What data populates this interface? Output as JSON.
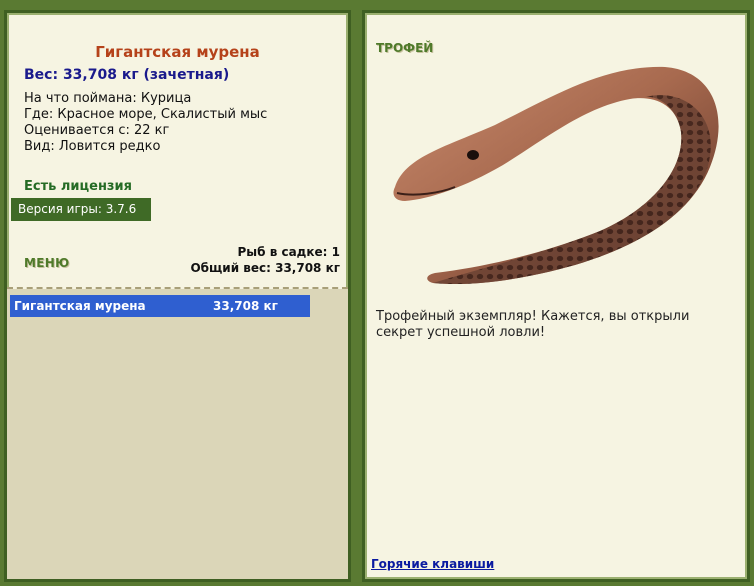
{
  "fish": {
    "name": "Гигантская мурена",
    "weight": "Вес: 33,708 кг (зачетная)",
    "bait": "На что поймана: Курица",
    "where": "Где: Красное море, Скалистый мыс",
    "value": "Оценивается с: 22 кг",
    "kind": "Вид: Ловится редко"
  },
  "license": "Есть лицензия",
  "version": {
    "label": "Версия игры: ",
    "number": "3.7.6"
  },
  "menu_label": "МЕНЮ",
  "net": {
    "count": "Рыб в садке: 1",
    "total": "Общий вес: 33,708 кг"
  },
  "catch_list": [
    {
      "name": "Гигантская мурена",
      "weight": "33,708 кг"
    }
  ],
  "trophy": {
    "label": "ТРОФЕЙ",
    "text": "Трофейный экземпляр! Кажется, вы открыли секрет успешной ловли!"
  },
  "hotkeys": "Горячие клавиши",
  "colors": {
    "background": "#5a7a32",
    "panel": "#f6f4e2",
    "fish_name": "#b5421a",
    "weight": "#1a1a8c",
    "selected_row": "#2f5fd0"
  }
}
